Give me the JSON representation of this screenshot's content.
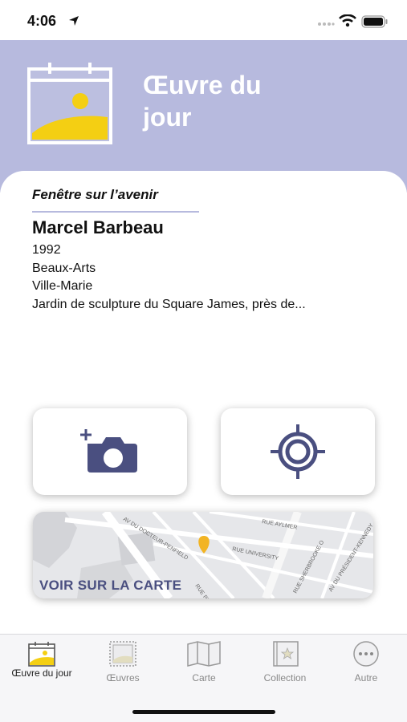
{
  "status": {
    "time": "4:06"
  },
  "hero": {
    "title": "Œuvre du jour"
  },
  "artwork": {
    "title": "Fenêtre sur l’avenir",
    "artist": "Marcel Barbeau",
    "year": "1992",
    "category": "Beaux-Arts",
    "borough": "Ville-Marie",
    "location": "Jardin de sculpture du Square James, près de..."
  },
  "actions": {
    "photo_icon": "camera-plus-icon",
    "locate_icon": "crosshair-icon"
  },
  "map": {
    "label": "VOIR SUR LA CARTE",
    "streets": [
      "AV DU DOCTEUR-PENFIELD",
      "RUE AYLMER",
      "RUE UNIVERSITY",
      "RUE SHERBROOKE O",
      "AV DU PRÉSIDENT-KENNEDY",
      "RUE PEEL"
    ]
  },
  "tabs": [
    {
      "label": "Œuvre du jour",
      "icon": "calendar-icon",
      "active": true
    },
    {
      "label": "Œuvres",
      "icon": "artwork-icon",
      "active": false
    },
    {
      "label": "Carte",
      "icon": "map-icon",
      "active": false
    },
    {
      "label": "Collection",
      "icon": "collection-icon",
      "active": false
    },
    {
      "label": "Autre",
      "icon": "more-icon",
      "active": false
    }
  ],
  "colors": {
    "accent": "#b7bade",
    "primary_dark": "#4a4f80",
    "highlight": "#f4cf13"
  }
}
